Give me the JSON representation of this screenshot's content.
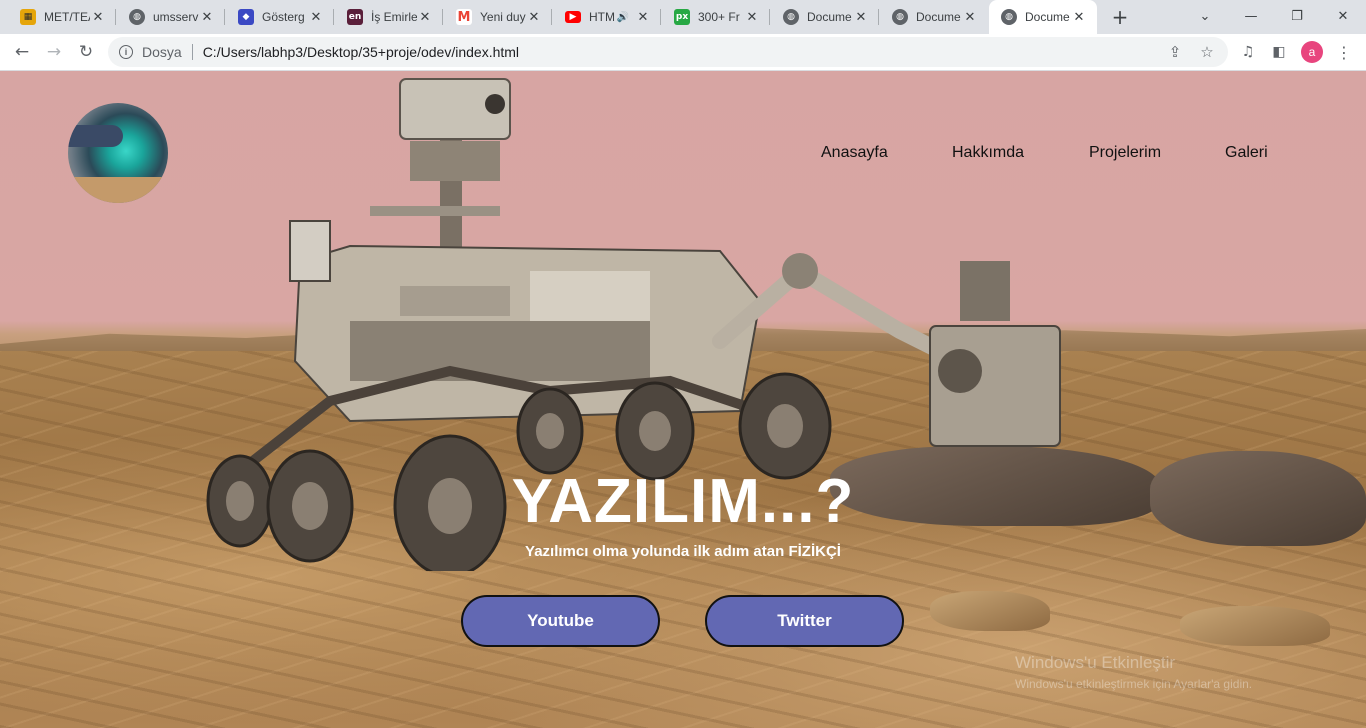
{
  "tabs": [
    {
      "title": "MET/TEA",
      "favicon": "met-icon",
      "color": "#e5a50a"
    },
    {
      "title": "umsserv",
      "favicon": "globe-icon",
      "color": "#5f6368"
    },
    {
      "title": "Gösterg",
      "favicon": "gosterge-icon",
      "color": "#3b49c4"
    },
    {
      "title": "İş Emirle",
      "favicon": "en-icon",
      "color": "#5a1f3a"
    },
    {
      "title": "Yeni duy",
      "favicon": "gmail-icon",
      "color": "#ea4335"
    },
    {
      "title": "HTM",
      "favicon": "youtube-icon",
      "color": "#ff0000"
    },
    {
      "title": "300+ Fr",
      "favicon": "px-icon",
      "color": "#27a844"
    },
    {
      "title": "Docume",
      "favicon": "globe-icon",
      "color": "#5f6368"
    },
    {
      "title": "Docume",
      "favicon": "globe-icon",
      "color": "#5f6368"
    },
    {
      "title": "Docume",
      "favicon": "globe-icon",
      "color": "#5f6368"
    }
  ],
  "active_tab": 9,
  "address": {
    "scheme_label": "Dosya",
    "url": "C:/Users/labhp3/Desktop/35+proje/odev/index.html"
  },
  "profile_initial": "a",
  "site": {
    "nav": [
      "Anasayfa",
      "Hakkımda",
      "Projelerim",
      "Galeri"
    ],
    "title": "YAZILIM...?",
    "subtitle": "Yazılımcı olma yolunda ilk adım atan FİZİKÇİ",
    "buttons": [
      "Youtube",
      "Twitter"
    ],
    "button_color": "#6268b3",
    "sky_color": "#d9a6a3"
  },
  "watermark": {
    "line1": "Windows'u Etkinleştir",
    "line2": "Windows'u etkinleştirmek için Ayarlar'a gidin."
  }
}
